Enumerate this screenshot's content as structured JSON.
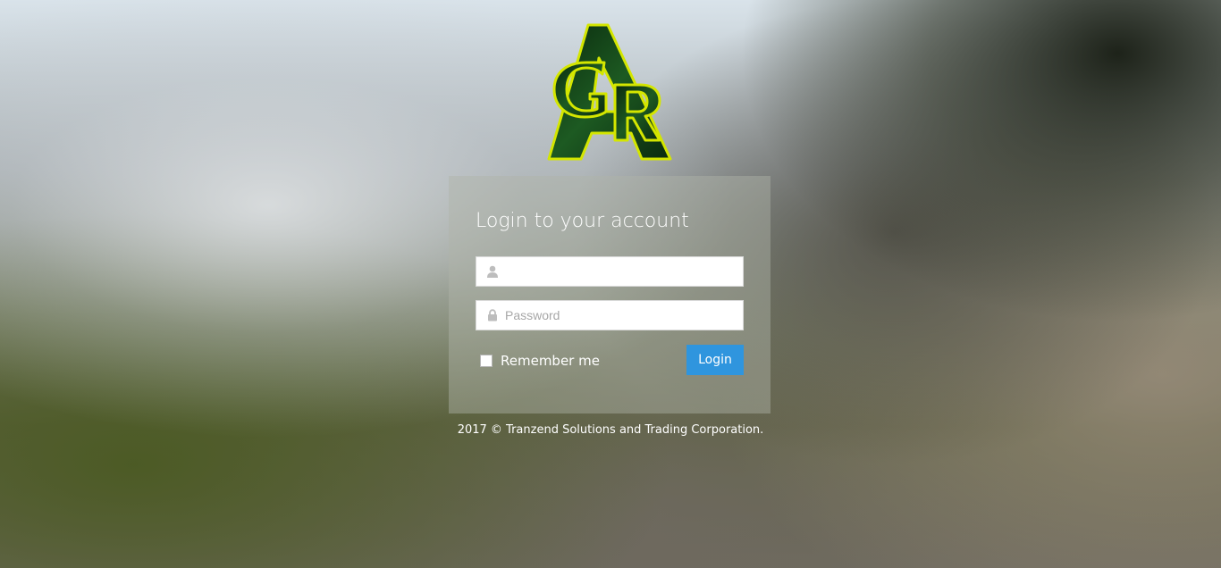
{
  "logo": {
    "letters": "AGR",
    "icon": "agr-logo",
    "colors": {
      "fill": "#0e3a14",
      "outline": "#d4e600"
    }
  },
  "login": {
    "title": "Login to your account",
    "username": {
      "value": "",
      "placeholder": "",
      "icon": "user-icon"
    },
    "password": {
      "value": "",
      "placeholder": "Password",
      "icon": "lock-icon"
    },
    "remember_label": "Remember me",
    "remember_checked": false,
    "submit_label": "Login"
  },
  "footer": {
    "text": "2017 © Tranzend Solutions and Trading Corporation."
  },
  "colors": {
    "accent": "#2f95de",
    "panel": "rgba(175,180,168,0.45)"
  }
}
